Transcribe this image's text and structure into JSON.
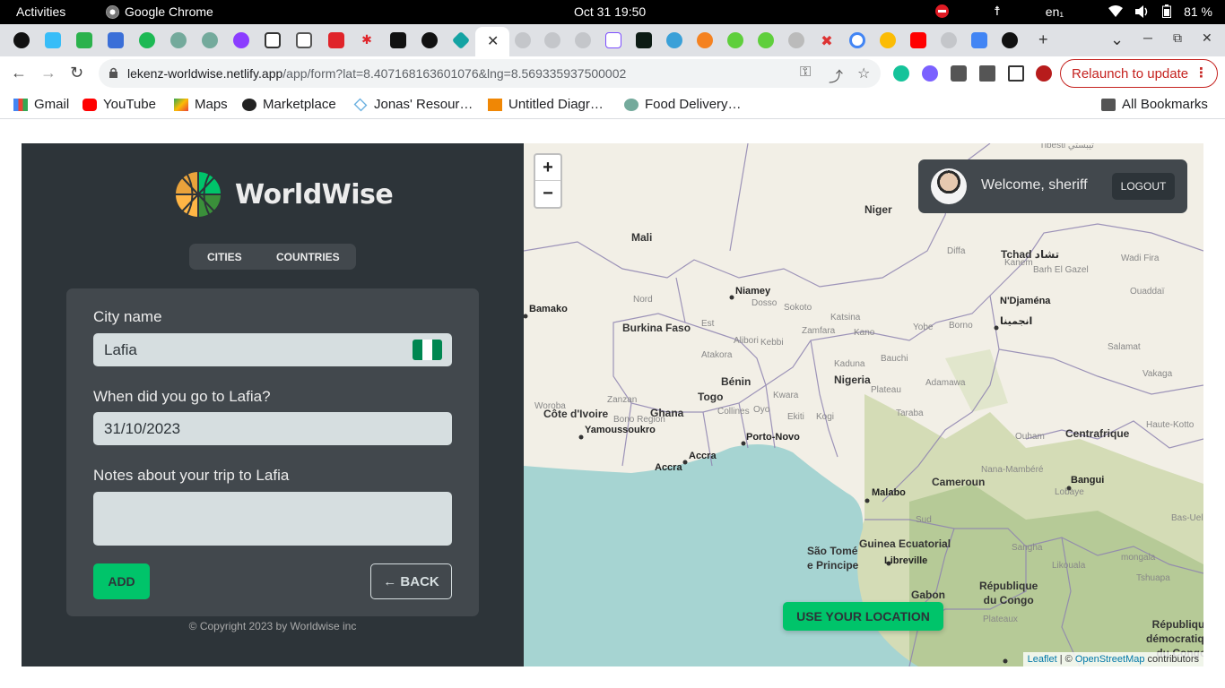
{
  "topbar": {
    "activities": "Activities",
    "app_name": "Google Chrome",
    "clock": "Oct 31  19:50",
    "lang": "en₁",
    "battery": "81 %"
  },
  "tabs": {
    "active_close": "✕",
    "new_tab": "+",
    "tab_search": "⌄",
    "minimize": "─",
    "restore": "⧉",
    "close_window": "✕"
  },
  "addressbar": {
    "host": "lekenz-worldwise.netlify.app",
    "path": "/app/form?lat=8.407168163601076&lng=8.569335937500002",
    "relaunch": "Relaunch to update"
  },
  "bookmarks": {
    "items": [
      "Gmail",
      "YouTube",
      "Maps",
      "Marketplace",
      "Jonas' Resour…",
      "Untitled Diagr…",
      "Food Delivery…"
    ],
    "all": "All Bookmarks"
  },
  "app": {
    "brand": "WorldWise",
    "nav": {
      "cities": "CITIES",
      "countries": "COUNTRIES"
    },
    "form": {
      "city_label": "City name",
      "city_value": "Lafia",
      "date_label": "When did you go to Lafia?",
      "date_value": "31/10/2023",
      "notes_label": "Notes about your trip to Lafia",
      "notes_value": "",
      "add": "ADD",
      "back": "← BACK"
    },
    "copyright": "© Copyright 2023 by Worldwise inc"
  },
  "map": {
    "zoom_in": "+",
    "zoom_out": "−",
    "welcome": "Welcome, sheriff",
    "logout": "LOGOUT",
    "use_location": "USE YOUR LOCATION",
    "attribution": {
      "leaflet": "Leaflet",
      "sep": " | © ",
      "osm": "OpenStreetMap",
      "tail": " contributors"
    },
    "labels": {
      "tibesti": "Tibesti تيبستي",
      "niger": "Niger",
      "mali": "Mali",
      "niamey": "Niamey",
      "bamako": "Bamako",
      "burkina": "Burkina Faso",
      "tchad": "Tchad تشاد",
      "ndjamena": "N'Djaména",
      "ndjamena_ar": "انجمينا",
      "benin": "Bénin",
      "nigeria": "Nigeria",
      "togo": "Togo",
      "ghana": "Ghana",
      "cote": "Côte d'Ivoire",
      "yamoussoukro": "Yamoussoukro",
      "accra": "Accra",
      "accra2": "Accra",
      "porto_novo": "Porto-Novo",
      "cameroun": "Cameroun",
      "malabo": "Malabo",
      "centrafrique": "Centrafrique",
      "bangui": "Bangui",
      "sao_tome": "São Tomé\ne Principe",
      "guinea": "Guinea Ecuatorial",
      "libreville": "Libreville",
      "gabon": "Gabon",
      "congo": "République\ndu Congo",
      "rdc": "République\ndémocratique\ndu Congo",
      "kanem": "Kanem",
      "diffa": "Diffa",
      "borno": "Borno",
      "yobe": "Yobe",
      "kano": "Kano",
      "kaduna": "Kaduna",
      "plateau": "Plateau",
      "adamawa": "Adamawa",
      "taraba": "Taraba",
      "bauchi": "Bauchi",
      "kwara": "Kwara",
      "oyo": "Oyo",
      "ekiti": "Ekiti",
      "kogi": "Kogi",
      "sokoto": "Sokoto",
      "zamfara": "Zamfara",
      "katsina": "Katsina",
      "kebbi": "Kebbi",
      "dosso": "Dosso",
      "nord": "Nord",
      "est": "Est",
      "sud": "Sud",
      "lobaye": "Lobaye",
      "salamat": "Salamat",
      "vakaga": "Vakaga",
      "ouaddai": "Ouaddaï",
      "wadi_fira": "Wadi Fira",
      "barh": "Barh El Gazel",
      "mono": "mongala",
      "likouala": "Likouala",
      "sangha": "Sangha",
      "tshuapa": "Tshuapa",
      "bas_uele": "Bas-Uele",
      "haute": "Haute-Kotto",
      "ouham": "Ouham",
      "nana": "Nana-Mambéré",
      "plateaux": "Plateaux",
      "woroba": "Woroba",
      "zanzan": "Zanzan",
      "bono": "Bono Region",
      "collines": "Collines",
      "atakora": "Atakora",
      "alibori": "Alibori"
    }
  },
  "colors": {
    "accent": "#00c46a",
    "dark1": "#2d3439",
    "dark2": "#42484d",
    "light": "#d6dee0",
    "sea": "#a6d4d2"
  }
}
